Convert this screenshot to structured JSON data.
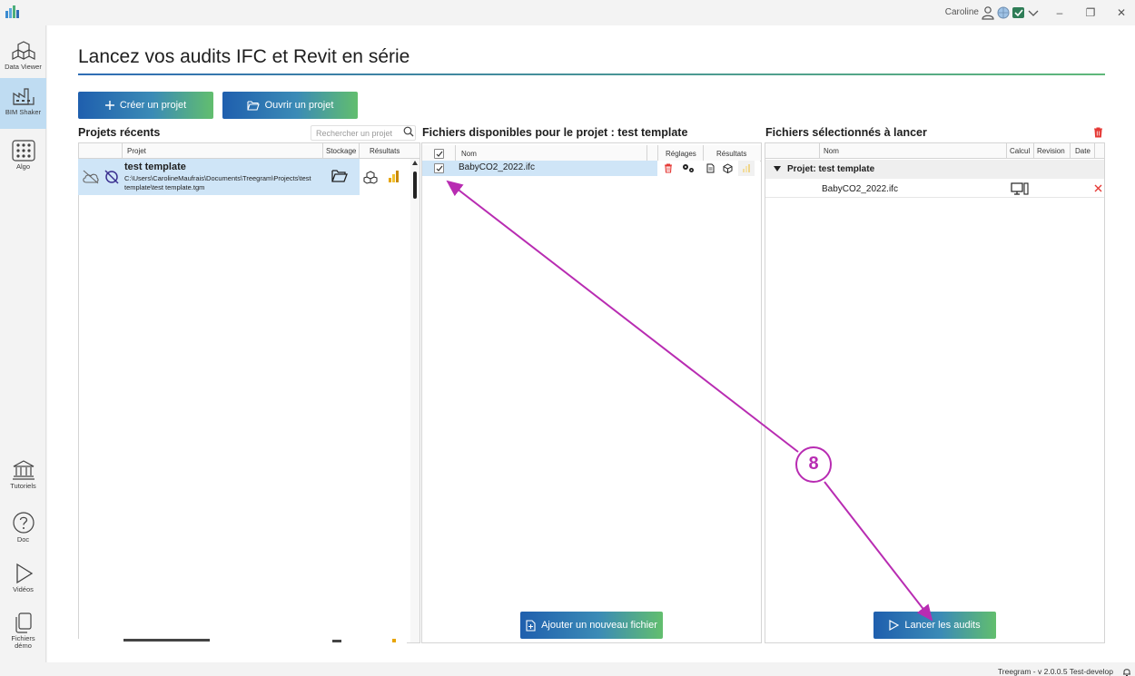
{
  "titlebar": {
    "user": "Caroline",
    "minimize": "–",
    "restore": "❐",
    "close": "✕"
  },
  "sidebar": {
    "items": [
      {
        "label": "Data Viewer"
      },
      {
        "label": "BIM Shaker"
      },
      {
        "label": "Algo"
      },
      {
        "label": "Tutoriels"
      },
      {
        "label": "Doc"
      },
      {
        "label": "Vidéos"
      },
      {
        "label": "Fichiers démo"
      }
    ]
  },
  "page": {
    "title": "Lancez vos audits IFC et Revit en série",
    "create_btn": "Créer un projet",
    "open_btn": "Ouvrir un projet"
  },
  "recent": {
    "title": "Projets récents",
    "search_placeholder": "Rechercher un projet",
    "columns": [
      "Projet",
      "Stockage",
      "Résultats"
    ],
    "project": {
      "name": "test template",
      "path": "C:\\Users\\CarolineMaufrais\\Documents\\Treegram\\Projects\\test template\\test template.tgm"
    }
  },
  "available": {
    "title": "Fichiers disponibles pour le projet : test template",
    "columns": [
      "Nom",
      "Réglages",
      "Résultats"
    ],
    "file": "BabyCO2_2022.ifc",
    "add_btn": "Ajouter un nouveau fichier"
  },
  "selected": {
    "title": "Fichiers sélectionnés à lancer",
    "columns": [
      "Nom",
      "Calcul",
      "Revision",
      "Date"
    ],
    "group": "Projet: test template",
    "file": "BabyCO2_2022.ifc",
    "launch_btn": "Lancer les audits"
  },
  "annotation": {
    "label": "8",
    "color": "#b82cb2"
  },
  "status": {
    "text": "Treegram - v 2.0.0.5 Test-develop"
  },
  "colors": {
    "accent_blue": "#1f5fae",
    "accent_green": "#62be6e",
    "selection": "#cfe5f7",
    "delete_red": "#e53935"
  }
}
